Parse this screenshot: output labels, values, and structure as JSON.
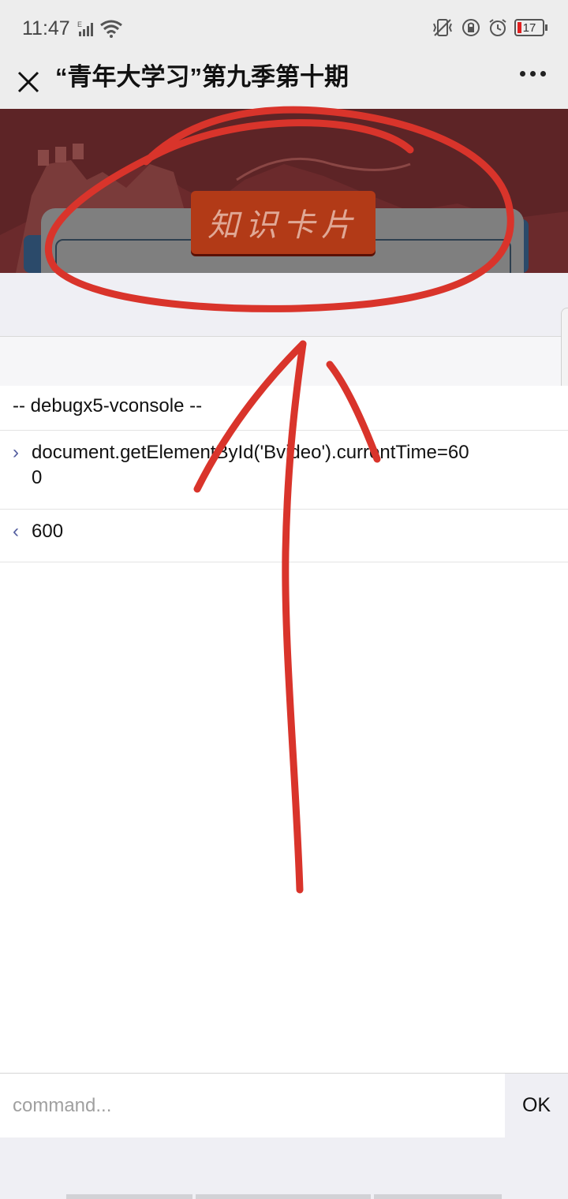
{
  "status_bar": {
    "time": "11:47",
    "network_label": "E",
    "battery_level": "17",
    "icons": [
      "signal-icon",
      "wifi-icon",
      "vibrate-icon",
      "rotation-lock-icon",
      "alarm-icon",
      "battery-icon"
    ]
  },
  "nav": {
    "title": "“青年大学习”第九季第十期",
    "close_icon": "close-icon",
    "more_icon": "more-icon"
  },
  "banner": {
    "badge_text": "知识卡片"
  },
  "console": {
    "header": "-- debugx5-vconsole --",
    "input_marker": "›",
    "input_command": "document.getElementById('Bvideo').currentTime=600",
    "output_marker": "‹",
    "output_value": "600"
  },
  "command_bar": {
    "placeholder": "command...",
    "ok_label": "OK"
  },
  "colors": {
    "annotation_red": "#d9342b",
    "banner_bg": "#5d2426",
    "badge_bg": "#b23a17",
    "marker_color": "#555fa0"
  }
}
